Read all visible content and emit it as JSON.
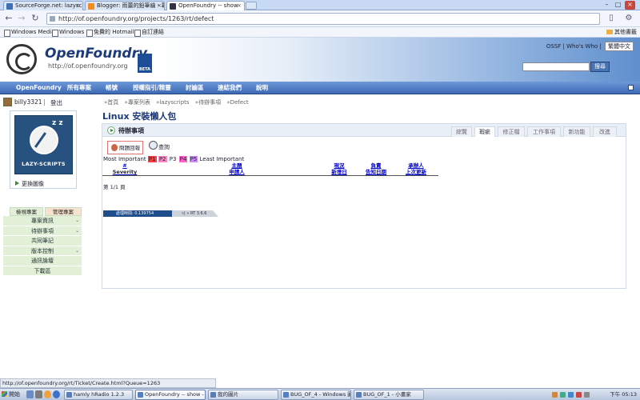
{
  "browser": {
    "tabs": [
      {
        "title": "SourceForge.net: lazyscripts..."
      },
      {
        "title": "Blogger: 雨蕾的鉛筆繪 - 幕..."
      },
      {
        "title": "OpenFoundry -- show"
      }
    ],
    "url": "http://of.openfoundry.org/projects/1263/rt/defect",
    "bookmarks": [
      "Windows Media",
      "Windows",
      "免費的 Hotmail",
      "自訂連結"
    ],
    "other_bookmarks": "其他書籤"
  },
  "site": {
    "name": "OpenFoundry",
    "url": "http://of.openfoundry.org",
    "toplinks": "OSSF | Who's Who |",
    "lang": "繁體中文",
    "search_button": "搜尋",
    "nav": [
      "OpenFoundry",
      "所有專案",
      "帳號",
      "授權指引/精靈",
      "討論區",
      "連結我們",
      "說明"
    ]
  },
  "user": {
    "name": "billy3321",
    "separator": "|",
    "logout": "登出"
  },
  "breadcrumb": [
    "»首頁",
    "»專案列表",
    "»lazyscripts",
    "»待辦事項",
    "»Defect"
  ],
  "project": {
    "title": "Linux 安裝懶人包",
    "logo_text": "LAZY-SCRIPTS",
    "logo_zz": "z z",
    "change_image": "更換圖像"
  },
  "sidebar": {
    "tabs": [
      "檢視專案",
      "管理專案"
    ],
    "items": [
      {
        "label": "專案資訊",
        "arrow": true
      },
      {
        "label": "待辦事項",
        "arrow": true
      },
      {
        "label": "共同筆記",
        "arrow": false
      },
      {
        "label": "版本控制",
        "arrow": true
      },
      {
        "label": "通訊論壇",
        "arrow": false
      },
      {
        "label": "下載區",
        "arrow": false
      }
    ]
  },
  "section": {
    "title": "待辦事項",
    "tabs": [
      "綜覽",
      "瑕疵",
      "修正檔",
      "工作事項",
      "新功能",
      "改進"
    ],
    "active_tab": "瑕疵"
  },
  "tickets": {
    "new_ticket": "問題回報",
    "query": "查詢",
    "legend_prefix": "Most Important",
    "priorities": [
      {
        "label": "P1",
        "color": "#ff3b3b"
      },
      {
        "label": "P2",
        "color": "#ff88c2"
      },
      {
        "label": "P3",
        "color": "#ffffff"
      },
      {
        "label": "P4",
        "color": "#ff66cc"
      },
      {
        "label": "P5",
        "color": "#d088ff"
      }
    ],
    "legend_suffix": "Least Important",
    "columns": [
      {
        "l1": "#",
        "l2": "Severity",
        "link": true
      },
      {
        "l1": "主題",
        "l2": "申請人",
        "link": true
      },
      {
        "l1": "現況",
        "l2": "新增日",
        "link": true
      },
      {
        "l1": "負責",
        "l2": "告知日期",
        "link": true
      },
      {
        "l1": "承辦人",
        "l2": "上次更新",
        "link": true
      }
    ],
    "page_info": "第 1/1 頁"
  },
  "footer": {
    "timer": "處理時間: 0.139754",
    "rt": "»| « RT 3.6.6"
  },
  "statusbar": "http://of.openfoundry.org/rt/Ticket/Create.html?Queue=1263",
  "taskbar": {
    "start": "開始",
    "tasks": [
      {
        "title": "hamly hRadio 1.2.3"
      },
      {
        "title": "OpenFoundry -- show - G..."
      },
      {
        "title": "我的圖片"
      },
      {
        "title": "BUG_OF_4 - Windows 圖..."
      },
      {
        "title": "BUG_OF_1 - 小畫家"
      }
    ],
    "clock": "下午 05:13"
  }
}
